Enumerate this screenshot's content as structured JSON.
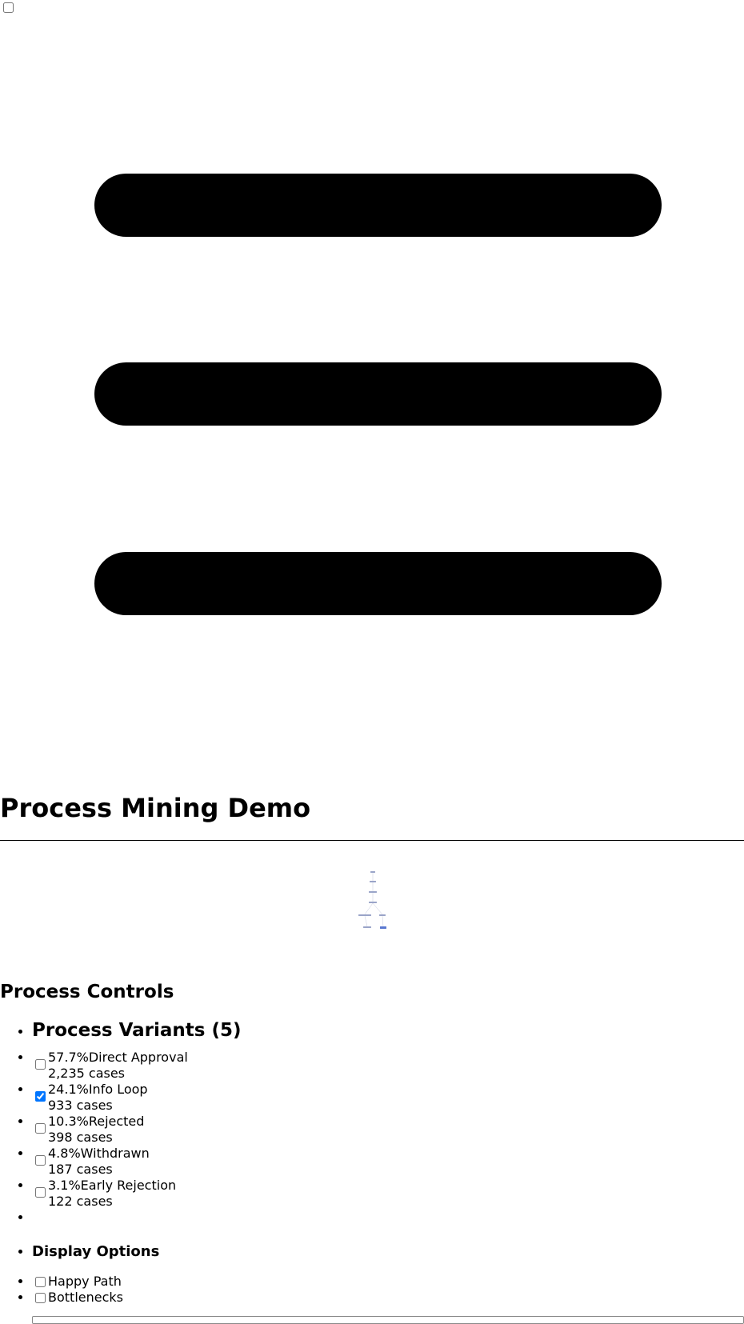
{
  "page": {
    "title": "Process Mining Demo"
  },
  "sidebar_toggle": {
    "checked": false
  },
  "controls": {
    "title": "Process Controls",
    "variants_heading": "Process Variants (5)",
    "variants": [
      {
        "percent": "57.7%",
        "name": "Direct Approval",
        "cases": "2,235 cases",
        "checked": false
      },
      {
        "percent": "24.1%",
        "name": "Info Loop",
        "cases": "933 cases",
        "checked": true
      },
      {
        "percent": "10.3%",
        "name": "Rejected",
        "cases": "398 cases",
        "checked": false
      },
      {
        "percent": "4.8%",
        "name": "Withdrawn",
        "cases": "187 cases",
        "checked": false
      },
      {
        "percent": "3.1%",
        "name": "Early Rejection",
        "cases": "122 cases",
        "checked": false
      }
    ],
    "display_heading": "Display Options",
    "display_options": [
      {
        "label": "Happy Path",
        "checked": false
      },
      {
        "label": "Bottlenecks",
        "checked": false
      }
    ]
  },
  "colors": {
    "diagram_node": "#9aa4c8",
    "diagram_accent": "#5a78d0",
    "checkbox_accent": "#1a73e8"
  },
  "icons": {
    "menu": "hamburger-menu-icon"
  }
}
